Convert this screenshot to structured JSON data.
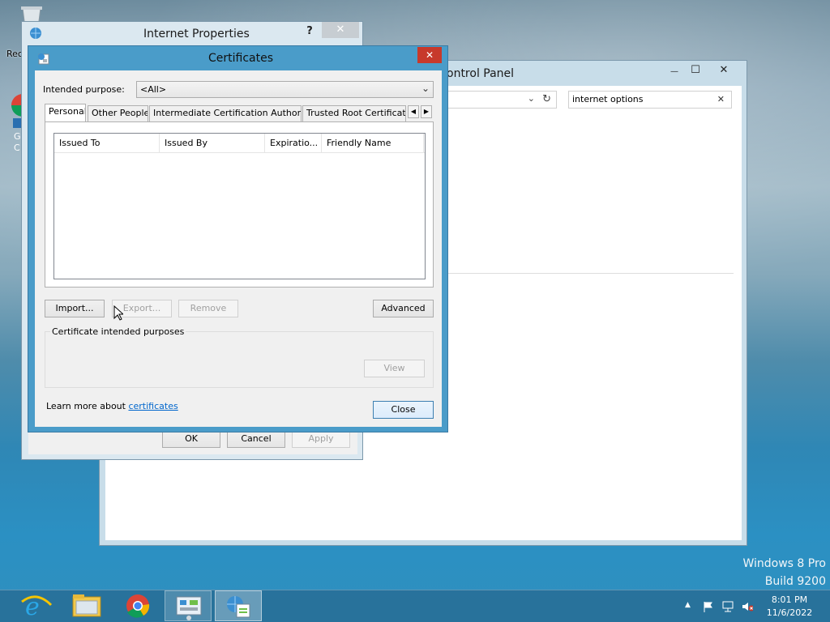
{
  "internet_properties": {
    "title": "Internet Properties",
    "help": "?",
    "close": "✕",
    "ok": "OK",
    "cancel": "Cancel",
    "apply": "Apply"
  },
  "control_panel": {
    "title_fragment": "ontrol Panel",
    "minimize": "—",
    "maximize": "☐",
    "close": "✕",
    "search_value": "internet options",
    "search_clear": "✕"
  },
  "certificates": {
    "title": "Certificates",
    "close": "✕",
    "intended_purpose_label": "Intended purpose:",
    "intended_purpose_value": "<All>",
    "tabs": [
      {
        "label": "Personal"
      },
      {
        "label": "Other People"
      },
      {
        "label": "Intermediate Certification Authorities"
      },
      {
        "label": "Trusted Root Certification"
      }
    ],
    "columns": [
      {
        "label": "Issued To"
      },
      {
        "label": "Issued By"
      },
      {
        "label": "Expiratio..."
      },
      {
        "label": "Friendly Name"
      }
    ],
    "import": "Import...",
    "export": "Export...",
    "remove": "Remove",
    "advanced": "Advanced",
    "purposes_group": "Certificate intended purposes",
    "view": "View",
    "learn_more_prefix": "Learn more about ",
    "learn_more_link": "certificates",
    "close_button": "Close"
  },
  "desktop": {
    "recycle_label_fragment": "Rec",
    "watermark_line1": "Windows 8 Pro",
    "watermark_line2": "Build 9200"
  },
  "taskbar": {
    "items": [
      {
        "icon": "internet-explorer-icon"
      },
      {
        "icon": "file-explorer-icon"
      },
      {
        "icon": "chrome-icon"
      },
      {
        "icon": "control-panel-icon"
      },
      {
        "icon": "internet-properties-icon"
      }
    ],
    "time": "8:01 PM",
    "date": "11/6/2022"
  },
  "colors": {
    "dialog_frame": "#4a9cc9",
    "title_close": "#c7392b",
    "link": "#0066cc"
  }
}
